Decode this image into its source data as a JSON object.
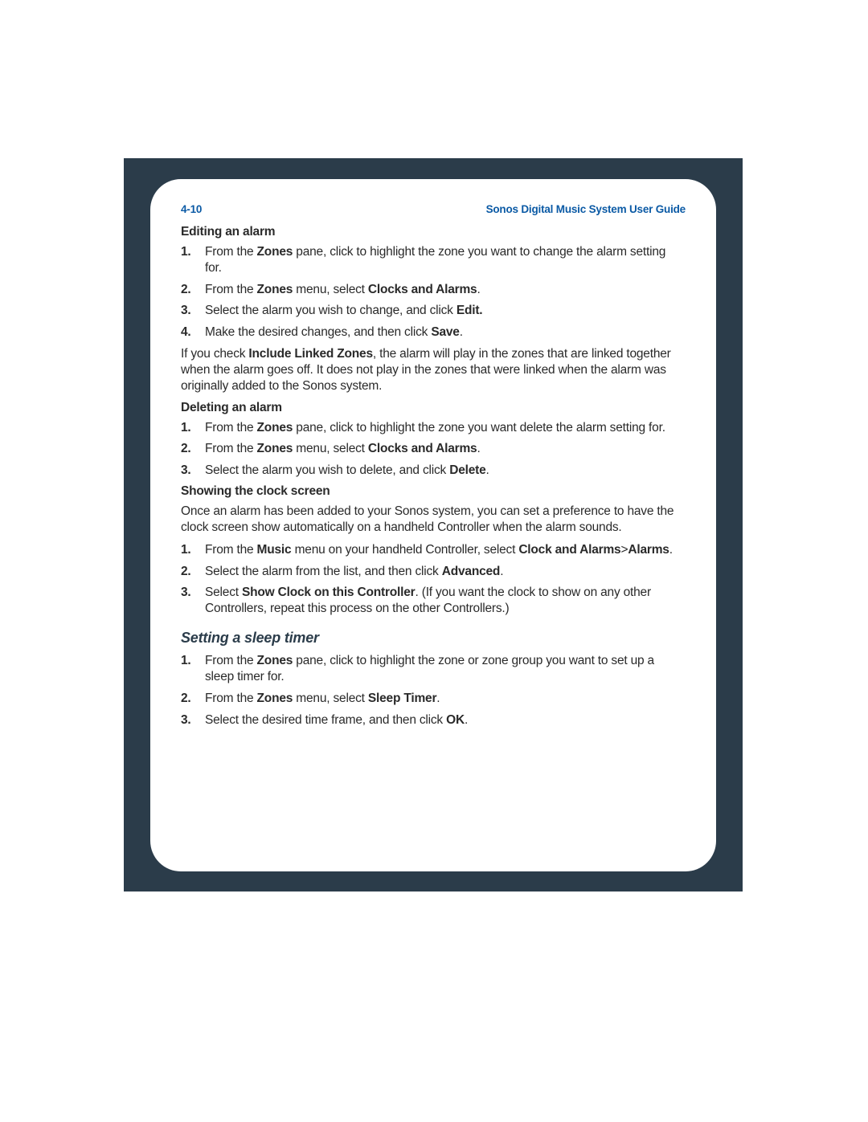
{
  "header": {
    "page_ref": "4-10",
    "doc_title": "Sonos Digital Music System User Guide"
  },
  "sections": {
    "editing": {
      "title": "Editing an alarm",
      "steps": {
        "s1a": "From the ",
        "s1b": "Zones",
        "s1c": " pane, click to highlight the zone you want to change the alarm setting for.",
        "s2a": "From the ",
        "s2b": "Zones",
        "s2c": " menu, select ",
        "s2d": "Clocks and Alarms",
        "s2e": ".",
        "s3a": "Select the alarm you wish to change, and click ",
        "s3b": "Edit.",
        "s4a": "Make the desired changes, and then click ",
        "s4b": "Save",
        "s4c": "."
      },
      "note_a": "If you check ",
      "note_b": "Include Linked Zones",
      "note_c": ", the alarm will play in the zones that are linked together when the alarm goes off. It does not play in the zones that were linked when the alarm was originally added to the Sonos system."
    },
    "deleting": {
      "title": "Deleting an alarm",
      "steps": {
        "s1a": "From the ",
        "s1b": "Zones",
        "s1c": " pane, click to highlight the zone you want delete the alarm setting for.",
        "s2a": "From the ",
        "s2b": "Zones",
        "s2c": " menu, select ",
        "s2d": "Clocks and Alarms",
        "s2e": ".",
        "s3a": "Select the alarm you wish to delete, and click ",
        "s3b": "Delete",
        "s3c": "."
      }
    },
    "showing": {
      "title": "Showing the clock screen",
      "intro": "Once an alarm has been added to your Sonos system, you can set a preference to have the clock screen show automatically on a handheld Controller when the alarm sounds.",
      "steps": {
        "s1a": "From the ",
        "s1b": "Music",
        "s1c": " menu on your handheld Controller, select ",
        "s1d": "Clock and Alarms",
        "s1e": ">",
        "s1f": "Alarms",
        "s1g": ".",
        "s2a": "Select the alarm from the list, and then click ",
        "s2b": "Advanced",
        "s2c": ".",
        "s3a": "Select ",
        "s3b": "Show Clock on this Controller",
        "s3c": ". (If you want the clock to show on any other Controllers, repeat this process on the other Controllers.)"
      }
    },
    "sleep": {
      "title": "Setting a sleep timer",
      "steps": {
        "s1a": "From the ",
        "s1b": "Zones",
        "s1c": " pane, click to highlight the zone or zone group you want to set up a sleep timer for.",
        "s2a": "From the ",
        "s2b": "Zones",
        "s2c": " menu, select ",
        "s2d": "Sleep Timer",
        "s2e": ".",
        "s3a": "Select the desired time frame, and then click ",
        "s3b": "OK",
        "s3c": "."
      }
    }
  }
}
